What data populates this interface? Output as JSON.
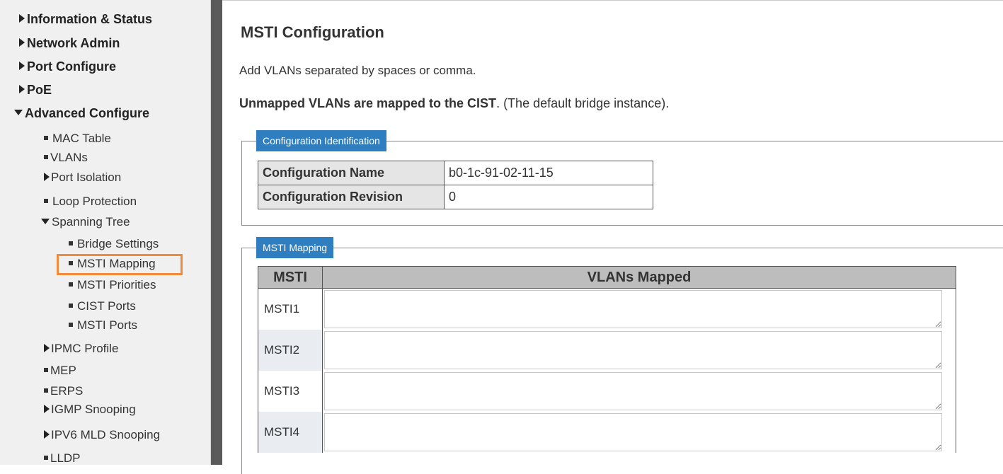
{
  "sidebar": {
    "top_items": [
      {
        "label": "Information & Status",
        "state": "collapsed"
      },
      {
        "label": "Network Admin",
        "state": "collapsed"
      },
      {
        "label": "Port Configure",
        "state": "collapsed"
      },
      {
        "label": "PoE",
        "state": "collapsed"
      },
      {
        "label": "Advanced Configure",
        "state": "expanded"
      }
    ],
    "advanced_items": [
      "MAC Table",
      "VLANs",
      "Port Isolation",
      "Loop Protection",
      "Spanning Tree",
      "IPMC Profile",
      "MEP",
      "ERPS",
      "IGMP Snooping",
      "IPV6 MLD Snooping",
      "LLDP"
    ],
    "spanning_tree_items": [
      "Bridge Settings",
      "MSTI Mapping",
      "MSTI Priorities",
      "CIST Ports",
      "MSTI Ports"
    ],
    "selected_item": "MSTI Mapping",
    "highlight_color": "#f28a3a"
  },
  "main": {
    "title": "MSTI Configuration",
    "intro": "Add VLANs separated by spaces or comma.",
    "unmapped_bold": "Unmapped VLANs are mapped to the CIST",
    "unmapped_rest": ". (The default bridge instance).",
    "config_id": {
      "legend": "Configuration Identification",
      "name_label": "Configuration Name",
      "name_value": "b0-1c-91-02-11-15",
      "revision_label": "Configuration Revision",
      "revision_value": "0"
    },
    "mapping": {
      "legend": "MSTI Mapping",
      "col_msti": "MSTI",
      "col_vlans": "VLANs Mapped",
      "rows": [
        {
          "name": "MSTI1",
          "vlans": ""
        },
        {
          "name": "MSTI2",
          "vlans": ""
        },
        {
          "name": "MSTI3",
          "vlans": ""
        },
        {
          "name": "MSTI4",
          "vlans": ""
        }
      ]
    }
  },
  "colors": {
    "legend_bg": "#2f7fc0",
    "divider": "#5a5a5a",
    "sidebar_bg": "#f0f0f0"
  }
}
